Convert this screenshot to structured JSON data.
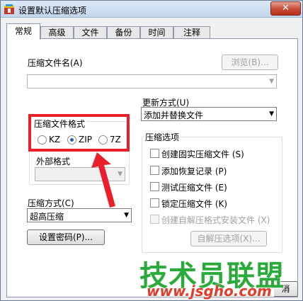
{
  "window": {
    "title": "设置默认压缩选项",
    "close_glyph": "✕"
  },
  "tabs": [
    {
      "label": "常规",
      "active": true
    },
    {
      "label": "高级",
      "active": false
    },
    {
      "label": "文件",
      "active": false
    },
    {
      "label": "备份",
      "active": false
    },
    {
      "label": "时间",
      "active": false
    },
    {
      "label": "注释",
      "active": false
    }
  ],
  "archive_name": {
    "label": "压缩文件名(A)",
    "value": "",
    "browse_label": "浏览(B)..."
  },
  "update_mode": {
    "label": "更新方式(U)",
    "value": "添加并替换文件"
  },
  "archive_format": {
    "title": "压缩文件格式",
    "options": [
      {
        "label": "KZ",
        "checked": false
      },
      {
        "label": "ZIP",
        "checked": true
      },
      {
        "label": "7Z",
        "checked": false
      }
    ],
    "external_label": "外部格式",
    "external_value": ""
  },
  "compression_method": {
    "label": "压缩方式(C)",
    "value": "超高压缩"
  },
  "set_password_label": "设置密码(P)...",
  "compression_options": {
    "title": "压缩选项",
    "items": [
      {
        "label": "创建固实压缩文件 (S)",
        "checked": false,
        "enabled": true
      },
      {
        "label": "添加恢复记录 (P)",
        "checked": false,
        "enabled": true
      },
      {
        "label": "测试压缩文件 (E)",
        "checked": false,
        "enabled": true
      },
      {
        "label": "锁定压缩文件 (K)",
        "checked": false,
        "enabled": true
      },
      {
        "label": "创建自解压格式安装文件 (X)",
        "checked": false,
        "enabled": false
      }
    ],
    "sfx_options_label": "自解压选项(X)..."
  },
  "ok_button_partial": "消",
  "watermark": {
    "title": "技术员联盟",
    "url": "www.jsgho.com"
  },
  "colors": {
    "highlight_red": "#ea1f2b",
    "watermark_green": "#2aaa3a",
    "watermark_red": "#e23d2a"
  }
}
